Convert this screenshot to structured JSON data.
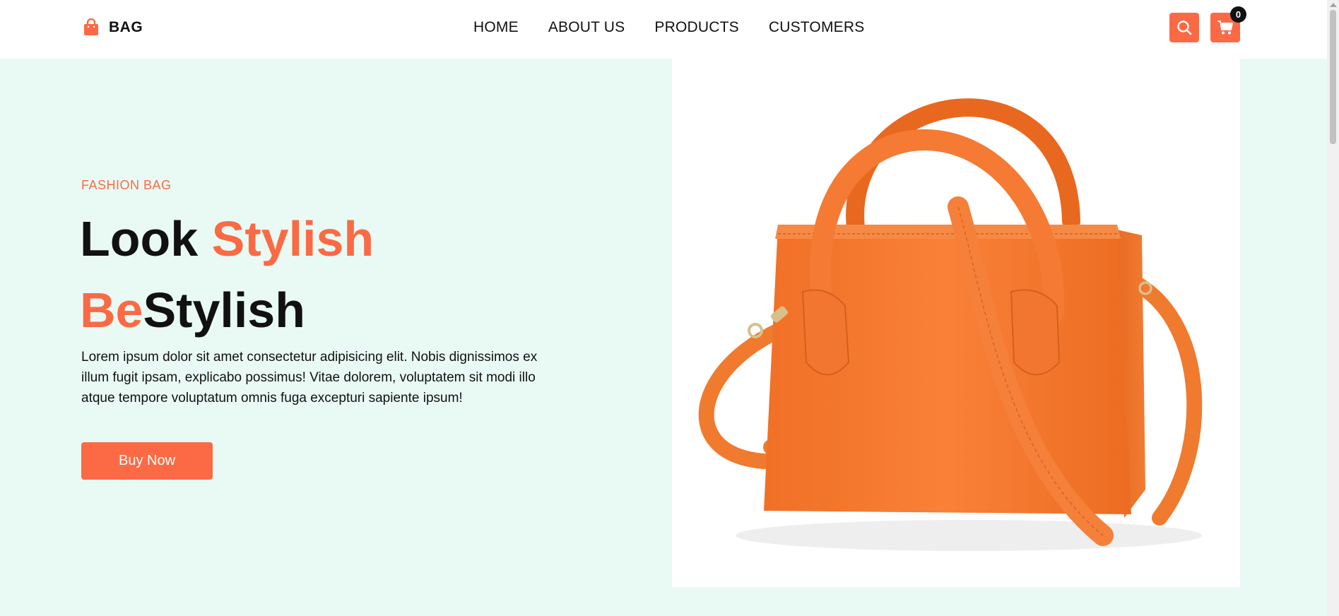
{
  "header": {
    "brand": "BAG",
    "nav": [
      "HOME",
      "ABOUT US",
      "PRODUCTS",
      "CUSTOMERS"
    ],
    "cart_count": "0"
  },
  "hero": {
    "eyebrow": "FASHION BAG",
    "headline": {
      "line1_a": "Look ",
      "line1_b": "Stylish",
      "line2_a": "Be",
      "line2_b": "Stylish"
    },
    "description": "Lorem ipsum dolor sit amet consectetur adipisicing elit. Nobis dignissimos ex illum fugit ipsam, explicabo possimus! Vitae dolorem, voluptatem sit modi illo atque tempore voluptatum omnis fuga excepturi sapiente ipsum!",
    "cta": "Buy Now"
  },
  "colors": {
    "accent": "#fb6a45",
    "hero_bg": "#e9faf4",
    "text": "#111111",
    "bag": "#f57a33"
  },
  "icons": [
    "shopping-bag-icon",
    "search-icon",
    "cart-icon"
  ]
}
